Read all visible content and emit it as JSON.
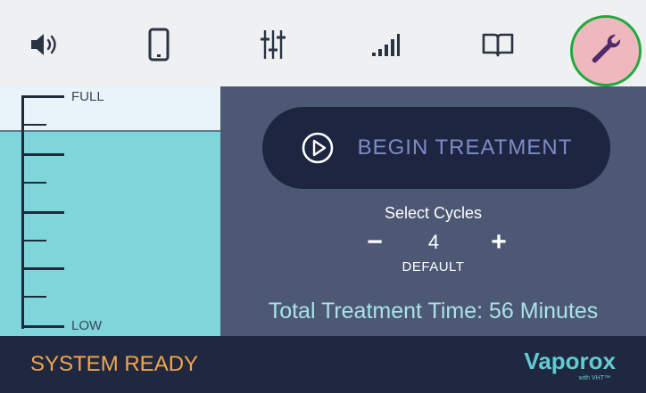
{
  "nav": {
    "icons": [
      "speaker-icon",
      "phone-icon",
      "sliders-icon",
      "signal-icon",
      "book-icon",
      "wrench-icon"
    ],
    "active": "wrench-icon",
    "active_color": "#efb8be",
    "highlight_ring_color": "#1faa3c"
  },
  "tank": {
    "full_label": "FULL",
    "low_label": "LOW",
    "water_level_fraction": 0.82,
    "water_color": "#7fd6da"
  },
  "treatment": {
    "begin_label": "BEGIN TREATMENT",
    "select_cycles_label": "Select Cycles",
    "decrement_symbol": "−",
    "increment_symbol": "+",
    "cycles_value": "4",
    "default_label": "DEFAULT",
    "total_time_text": "Total Treatment Time: 56 Minutes"
  },
  "status": {
    "text": "SYSTEM READY",
    "text_color": "#f4a64a",
    "brand": "Vaporox",
    "brand_sub": "with VHT™"
  }
}
